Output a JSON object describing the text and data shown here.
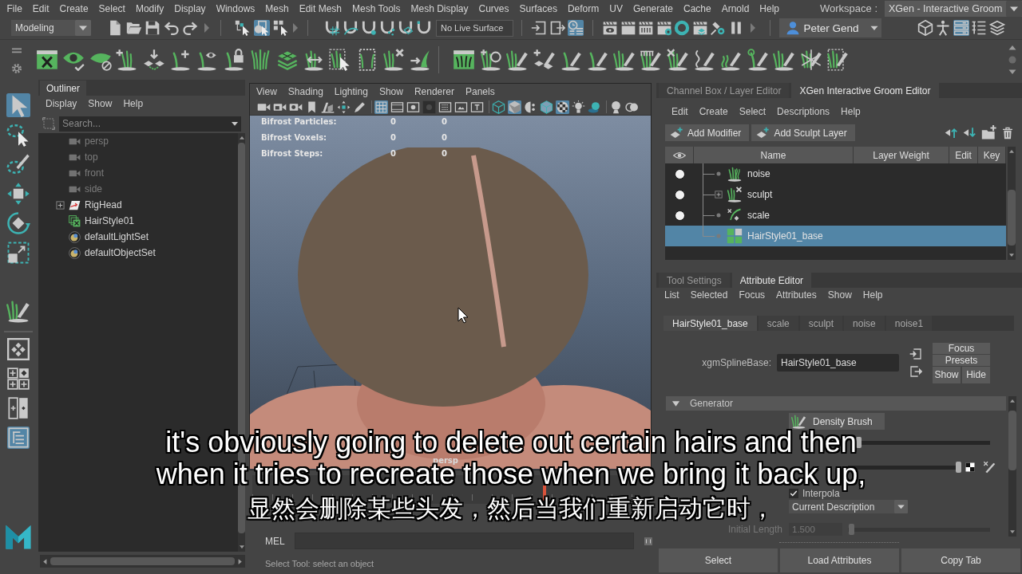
{
  "menu_bar": {
    "items": [
      "File",
      "Edit",
      "Create",
      "Select",
      "Modify",
      "Display",
      "Windows",
      "Mesh",
      "Edit Mesh",
      "Mesh Tools",
      "Mesh Display",
      "Curves",
      "Surfaces",
      "Deform",
      "UV",
      "Generate",
      "Cache",
      "Arnold",
      "Help"
    ],
    "workspace_label": "Workspace :",
    "workspace": "XGen - Interactive Groom"
  },
  "status_line": {
    "menu_set": "Modeling",
    "select_modes": [
      {
        "selected": false
      },
      {
        "selected": true
      },
      {
        "selected": false
      }
    ],
    "snaps": [
      {
        "selected": false
      },
      {
        "selected": false
      },
      {
        "selected": false
      },
      {
        "selected": false
      },
      {
        "selected": false
      },
      {
        "selected": false
      }
    ],
    "live_surface": "No Live Surface",
    "history_tools": [
      {
        "selected": false
      },
      {
        "selected": false
      },
      {
        "selected": true
      }
    ],
    "user": "Peter Gend",
    "panel_toggles": [
      {
        "selected": false
      },
      {
        "selected": false
      },
      {
        "selected": true
      },
      {
        "selected": false
      },
      {
        "selected": false
      }
    ]
  },
  "toolbox": {
    "tools": [
      {
        "selected": true
      },
      {
        "selected": false
      },
      {
        "selected": false
      },
      {
        "selected": false
      },
      {
        "selected": false
      },
      {
        "selected": false
      },
      {
        "selected": false
      }
    ],
    "layouts": [
      {
        "selected": false
      },
      {
        "selected": false
      },
      {
        "selected": false
      },
      {
        "selected": true
      }
    ]
  },
  "outliner": {
    "title": "Outliner",
    "menu": [
      "Display",
      "Show",
      "Help"
    ],
    "search_placeholder": "Search...",
    "items": [
      {
        "label": "persp",
        "kind": "camera",
        "dimmed": true,
        "collapsed": false
      },
      {
        "label": "top",
        "kind": "camera",
        "dimmed": true,
        "collapsed": false
      },
      {
        "label": "front",
        "kind": "camera",
        "dimmed": true,
        "collapsed": false
      },
      {
        "label": "side",
        "kind": "camera",
        "dimmed": true,
        "collapsed": false
      },
      {
        "label": "RigHead",
        "kind": "rig",
        "dimmed": false,
        "collapsed": true
      },
      {
        "label": "HairStyle01",
        "kind": "xgen",
        "dimmed": false,
        "collapsed": false
      },
      {
        "label": "defaultLightSet",
        "kind": "set",
        "dimmed": false,
        "collapsed": false
      },
      {
        "label": "defaultObjectSet",
        "kind": "set",
        "dimmed": false,
        "collapsed": false
      }
    ]
  },
  "viewport": {
    "menu": [
      "View",
      "Shading",
      "Lighting",
      "Show",
      "Renderer",
      "Panels"
    ],
    "tools": [
      {
        "selected": false
      },
      {
        "selected": false
      },
      {
        "selected": false
      },
      {
        "selected": false
      },
      {
        "selected": false
      },
      {
        "selected": false
      },
      {
        "selected": false
      },
      {
        "selected": true
      },
      {
        "selected": false
      },
      {
        "selected": false
      },
      {
        "selected": false
      },
      {
        "selected": false
      },
      {
        "selected": false
      },
      {
        "selected": false
      },
      {
        "selected": false
      },
      {
        "selected": true
      },
      {
        "selected": false
      },
      {
        "selected": false
      },
      {
        "selected": true
      },
      {
        "selected": false
      },
      {
        "selected": false
      },
      {
        "selected": false
      },
      {
        "selected": false
      }
    ],
    "hud": [
      {
        "label": "Bifrost Particles:",
        "values": [
          "0",
          "0"
        ]
      },
      {
        "label": "Bifrost Voxels:",
        "values": [
          "0",
          "0"
        ]
      },
      {
        "label": "Bifrost Steps:",
        "values": [
          "0",
          "0"
        ]
      }
    ],
    "camera": "persp"
  },
  "command_line": {
    "language": "MEL"
  },
  "help_line": "Select Tool: select an object",
  "groom_editor": {
    "tabs": [
      {
        "label": "Channel Box / Layer Editor",
        "selected": false
      },
      {
        "label": "XGen Interactive Groom Editor",
        "selected": true
      }
    ],
    "menu": [
      "Edit",
      "Create",
      "Select",
      "Descriptions",
      "Help"
    ],
    "buttons": [
      "Add Modifier",
      "Add Sculpt Layer"
    ],
    "columns": [
      "Name",
      "Layer Weight",
      "Edit",
      "Key"
    ],
    "rows": [
      {
        "name": "noise",
        "kind": "noise",
        "visible": true,
        "collapsed": false,
        "selected": false
      },
      {
        "name": "sculpt",
        "kind": "sculpt",
        "visible": true,
        "collapsed": true,
        "selected": false
      },
      {
        "name": "scale",
        "kind": "scale",
        "visible": true,
        "collapsed": false,
        "selected": false
      },
      {
        "name": "HairStyle01_base",
        "kind": "base",
        "visible": false,
        "collapsed": false,
        "selected": true
      }
    ]
  },
  "attribute_editor": {
    "tabs": [
      {
        "label": "Tool Settings",
        "selected": false
      },
      {
        "label": "Attribute Editor",
        "selected": true
      }
    ],
    "menu": [
      "List",
      "Selected",
      "Focus",
      "Attributes",
      "Show",
      "Help"
    ],
    "node_tabs": [
      {
        "label": "HairStyle01_base",
        "selected": true
      },
      {
        "label": "scale",
        "selected": false
      },
      {
        "label": "sculpt",
        "selected": false
      },
      {
        "label": "noise",
        "selected": false
      },
      {
        "label": "noise1",
        "selected": false
      }
    ],
    "node_label": "xgmSplineBase:",
    "node_name": "HairStyle01_base",
    "side_buttons": [
      "Focus",
      "Presets",
      "Show",
      "Hide"
    ],
    "section": {
      "title": "Generator",
      "expanded": true
    },
    "brush_button": "Density Brush",
    "density_slider": {
      "level": 0.04
    },
    "mask_slider": {
      "level": 0.98
    },
    "interpolate": {
      "label": "Interpola",
      "checked": true
    },
    "create_from": {
      "value": "Current Description"
    },
    "initial_length": {
      "label": "Initial Length",
      "value": "1.500",
      "level": 0.02,
      "disabled": true
    },
    "footer_buttons": [
      "Select",
      "Load Attributes",
      "Copy Tab"
    ]
  },
  "subtitles": [
    "it's obviously going to delete out certain hairs and then",
    "when it tries to recreate those when we bring it back up,",
    "显然会删除某些头发，然后当我们重新启动它时，"
  ]
}
